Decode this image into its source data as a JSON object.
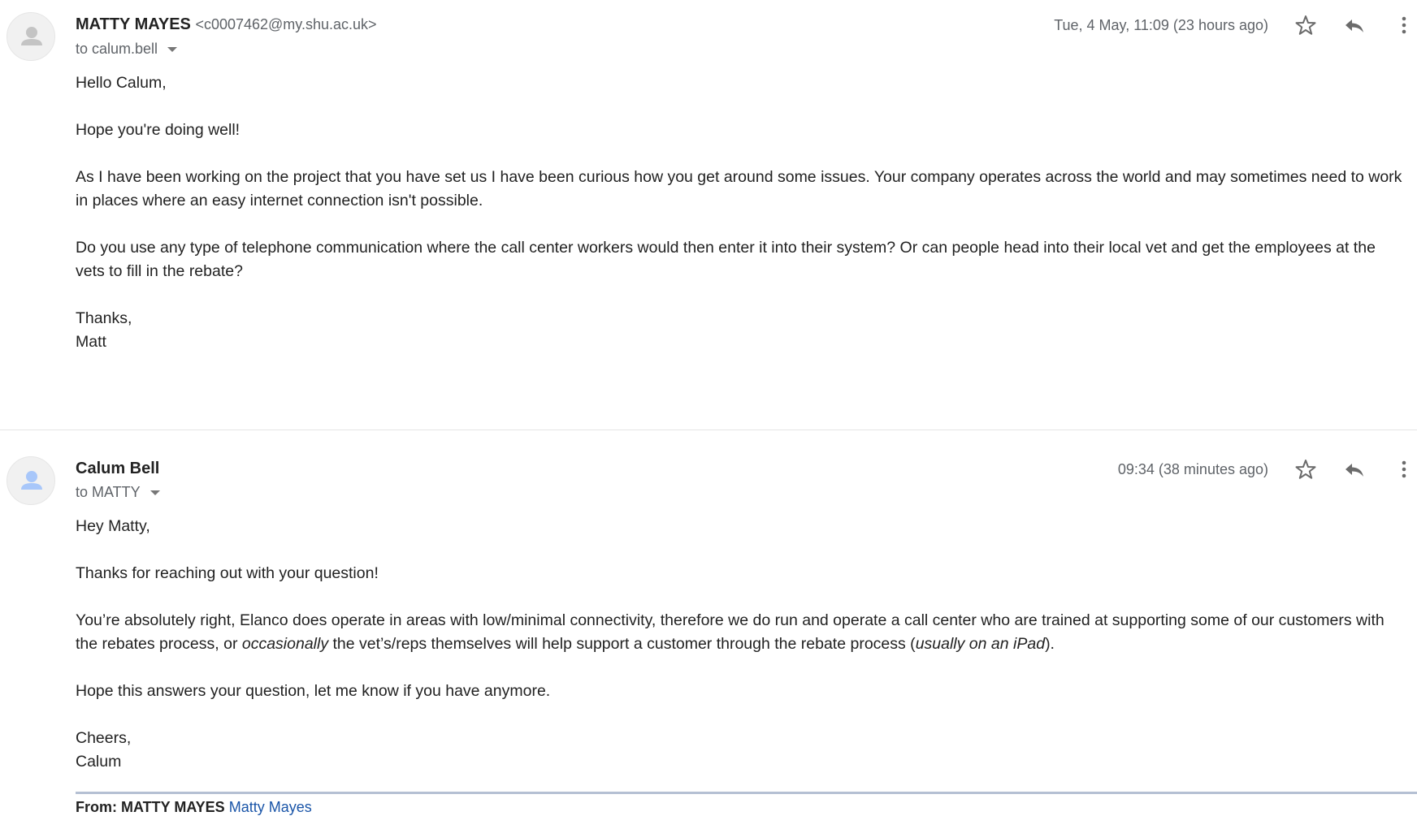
{
  "messages": [
    {
      "sender_name": "MATTY MAYES",
      "sender_email": "<c0007462@my.shu.ac.uk>",
      "to": "to calum.bell",
      "timestamp": "Tue, 4 May, 11:09 (23 hours ago)",
      "avatar_color": "#c4c4c4",
      "body": [
        "Hello Calum,",
        "Hope you're doing well!",
        "As I have been working on the project that you have set us I have been curious how you get around some issues. Your company operates across the world and may sometimes need to work in places where an easy internet connection isn't possible.",
        "Do you use any type of telephone communication where the call center workers would then enter it into their system? Or can people head into their local vet and get the employees at the vets to fill in the rebate?"
      ],
      "signoff": "Thanks,",
      "signature": "Matt"
    },
    {
      "sender_name": "Calum Bell",
      "to": "to MATTY",
      "timestamp": "09:34 (38 minutes ago)",
      "avatar_color": "#a8c7fa",
      "body": [
        "Hey Matty,",
        "Thanks for reaching out with your question!"
      ],
      "para3": {
        "a": "You’re absolutely right, Elanco does operate in areas with low/minimal connectivity, therefore we do run and operate a call center who are trained at supporting some of our customers with the rebates process, or ",
        "b": "occasionally",
        "c": " the vet’s/reps themselves will help support a customer through the rebate process (",
        "d": "usually on an iPad",
        "e": ")."
      },
      "para4": "Hope this answers your question, let me know if you have anymore.",
      "signoff": "Cheers,",
      "signature": "Calum",
      "quoted_from": "From: MATTY MAYES",
      "quoted_link": "Matty Mayes"
    }
  ],
  "icons": [
    "person-icon",
    "star-icon",
    "reply-icon",
    "more-vert-icon",
    "chevron-down-icon"
  ]
}
